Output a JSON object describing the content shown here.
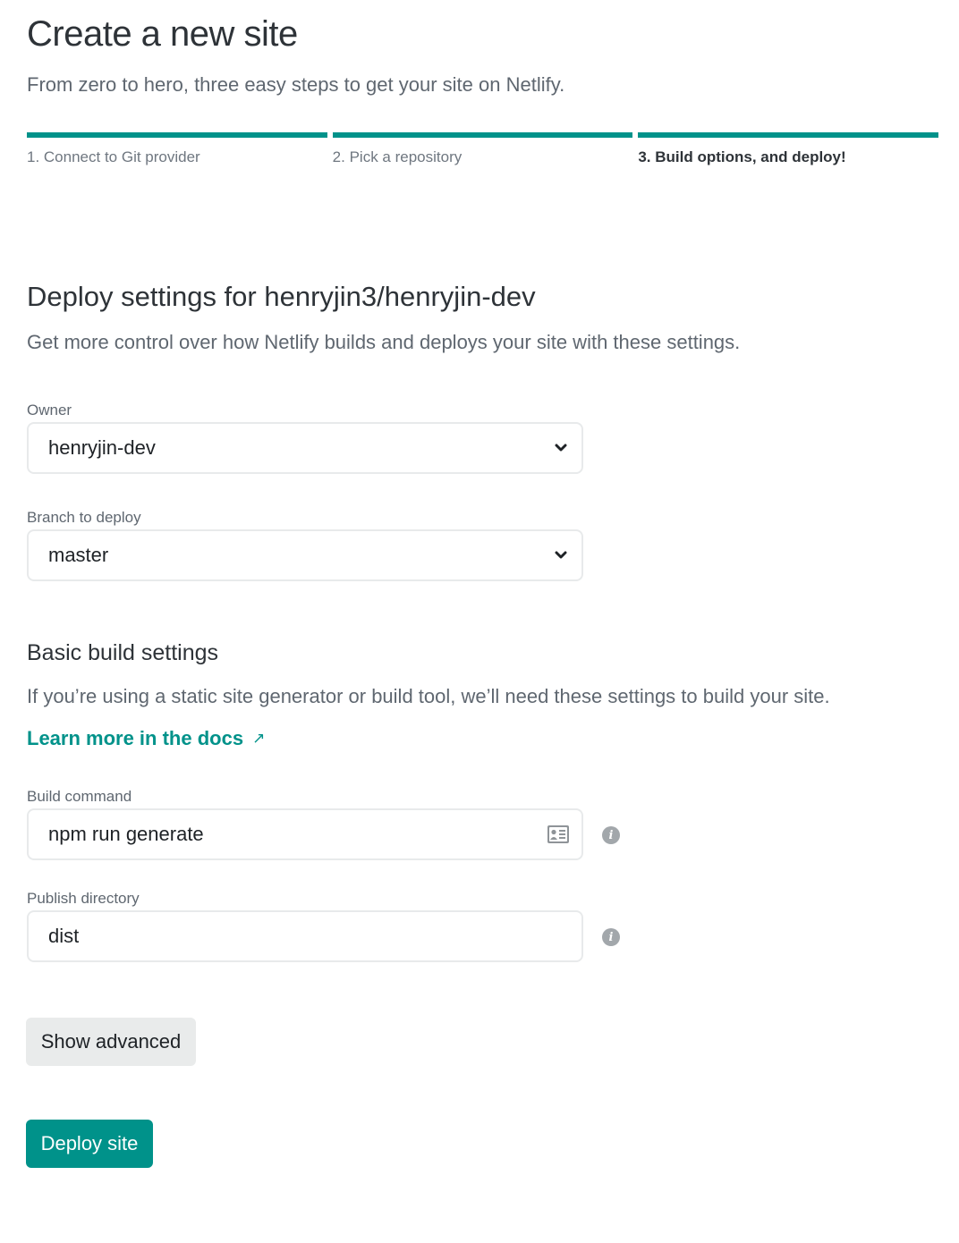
{
  "header": {
    "title": "Create a new site",
    "subtitle": "From zero to hero, three easy steps to get your site on Netlify."
  },
  "steps": [
    {
      "label": "1. Connect to Git provider",
      "active": false
    },
    {
      "label": "2. Pick a repository",
      "active": false
    },
    {
      "label": "3. Build options, and deploy!",
      "active": true
    }
  ],
  "deploy_settings": {
    "title": "Deploy settings for henryjin3/henryjin-dev",
    "description": "Get more control over how Netlify builds and deploys your site with these settings.",
    "owner": {
      "label": "Owner",
      "value": "henryjin-dev"
    },
    "branch": {
      "label": "Branch to deploy",
      "value": "master"
    }
  },
  "build_settings": {
    "title": "Basic build settings",
    "description": "If you’re using a static site generator or build tool, we’ll need these settings to build your site.",
    "docs_link": "Learn more in the docs",
    "docs_link_icon": "↗",
    "build_command": {
      "label": "Build command",
      "value": "npm run generate"
    },
    "publish_directory": {
      "label": "Publish directory",
      "value": "dist"
    },
    "info_icon_glyph": "i"
  },
  "actions": {
    "show_advanced": "Show advanced",
    "deploy": "Deploy site"
  },
  "colors": {
    "accent": "#00928a",
    "text_primary": "#2e3338",
    "text_secondary": "#5f6770",
    "secondary_button_bg": "#e9ebeb",
    "info_icon": "#a2a7ab"
  }
}
